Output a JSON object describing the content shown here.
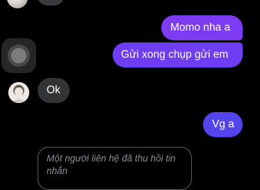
{
  "messages": {
    "outgoing_1": "Momo nha a",
    "outgoing_2": "Gửi xong chụp gửi em",
    "incoming_1": "Ok",
    "outgoing_3": "Vg a",
    "recalled_notice": "Một người liên hệ đã thu hồi tin nhắn"
  },
  "colors": {
    "background": "#000000",
    "outgoing_bubble_top": "#7e3bf4",
    "outgoing_bubble_bottom": "#5444ec",
    "incoming_bubble": "#333436",
    "recalled_text": "#8d8d90"
  },
  "icons": {
    "assistive_touch": "assistive-touch-icon",
    "contact_avatar": "avatar"
  }
}
